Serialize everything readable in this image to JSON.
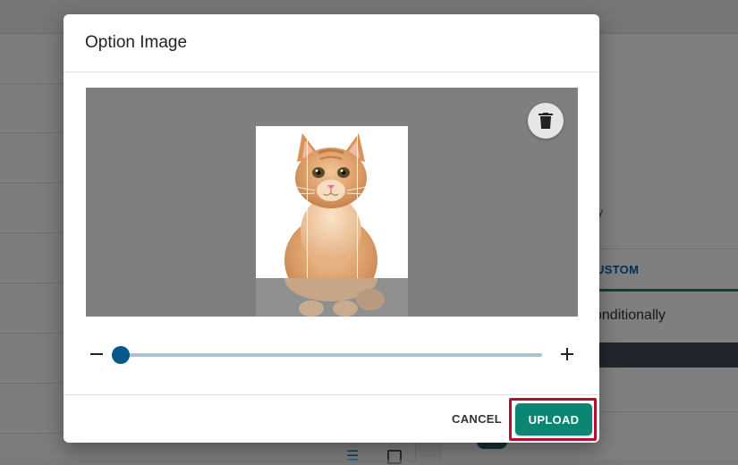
{
  "background": {
    "tab_label": "USTOM",
    "condition_text": "onditionally",
    "mini_text": "y"
  },
  "dialog": {
    "title": "Option Image",
    "cancel_label": "CANCEL",
    "upload_label": "UPLOAD",
    "zoom_level": 0,
    "icons": {
      "delete": "trash-icon",
      "zoom_out": "minus-icon",
      "zoom_in": "plus-icon"
    }
  },
  "colors": {
    "primary_button": "#0b8672",
    "highlight_border": "#b50f2f",
    "slider_thumb": "#06598a",
    "slider_track": "#a9c3d1"
  }
}
